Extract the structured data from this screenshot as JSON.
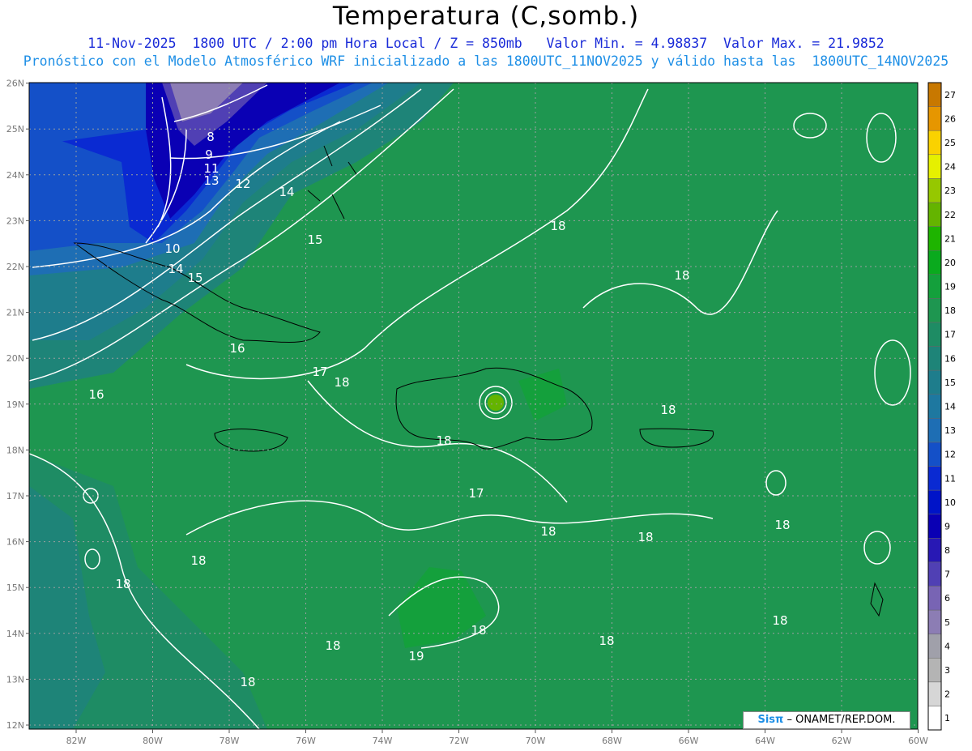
{
  "header": {
    "title": "Temperatura (C,somb.)",
    "line1": "11-Nov-2025  1800 UTC / 2:00 pm Hora Local / Z = 850mb   Valor Min. = 4.98837  Valor Max. = 21.9852",
    "line2": "Pronóstico con el Modelo Atmosférico WRF inicializado a las 1800UTC_11NOV2025 y válido hasta las  1800UTC_14NOV2025"
  },
  "map": {
    "lon_labels": [
      "82W",
      "80W",
      "78W",
      "76W",
      "74W",
      "72W",
      "70W",
      "68W",
      "66W",
      "64W",
      "62W",
      "60W"
    ],
    "lat_labels": [
      "12N",
      "13N",
      "14N",
      "15N",
      "16N",
      "17N",
      "18N",
      "19N",
      "20N",
      "21N",
      "22N",
      "23N",
      "24N",
      "25N",
      "26N"
    ],
    "contour_labels": [
      "8",
      "9",
      "11",
      "13",
      "12",
      "14",
      "10",
      "14",
      "15",
      "15",
      "16",
      "17",
      "18",
      "16",
      "18",
      "18",
      "18",
      "18",
      "17",
      "18",
      "18",
      "18",
      "18",
      "19",
      "18",
      "18",
      "18",
      "18",
      "18",
      "18"
    ]
  },
  "colorbar": {
    "levels": [
      "1",
      "2",
      "3",
      "4",
      "5",
      "6",
      "7",
      "8",
      "9",
      "10",
      "11",
      "12",
      "13",
      "14",
      "15",
      "16",
      "17",
      "18",
      "19",
      "20",
      "21",
      "22",
      "23",
      "24",
      "25",
      "26",
      "27"
    ],
    "colors": [
      "#ffffff",
      "#d6d6d6",
      "#b4b4b4",
      "#a0a0aa",
      "#8c7db4",
      "#7864b4",
      "#5040b4",
      "#2818b4",
      "#0a00b4",
      "#0014c8",
      "#0a2ad2",
      "#1450c8",
      "#1e6eb4",
      "#1e78a0",
      "#1e7d8c",
      "#1e8478",
      "#1e8c64",
      "#1e9650",
      "#14a03c",
      "#0aaa1e",
      "#1eb400",
      "#64b400",
      "#96c800",
      "#e6f000",
      "#fad200",
      "#e69600",
      "#c87800"
    ]
  },
  "credit": {
    "sis": "Sisπ",
    "text": "– ONAMET/REP.DOM."
  }
}
